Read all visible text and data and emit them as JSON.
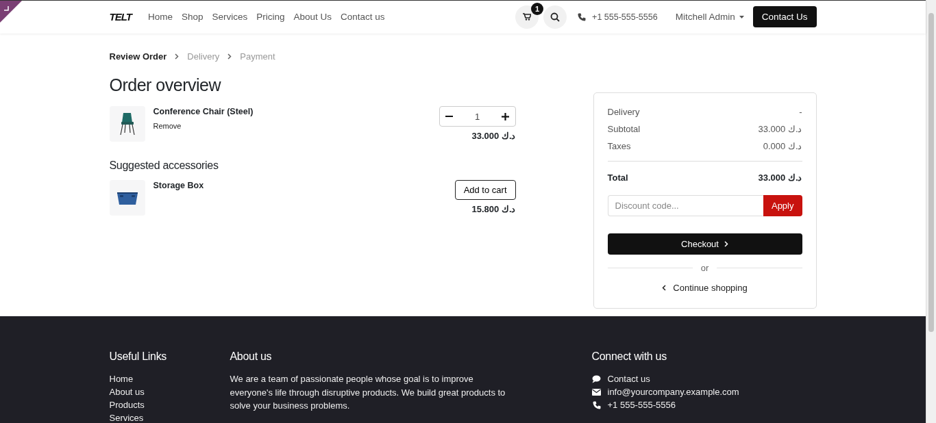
{
  "header": {
    "brand": "TELT",
    "nav": [
      {
        "label": "Home"
      },
      {
        "label": "Shop"
      },
      {
        "label": "Services"
      },
      {
        "label": "Pricing"
      },
      {
        "label": "About Us"
      },
      {
        "label": "Contact us"
      }
    ],
    "cart_count": "1",
    "phone": "+1 555-555-5556",
    "user": "Mitchell Admin",
    "cta": "Contact Us"
  },
  "steps": [
    {
      "label": "Review Order",
      "current": true
    },
    {
      "label": "Delivery",
      "current": false
    },
    {
      "label": "Payment",
      "current": false
    }
  ],
  "order": {
    "title": "Order overview",
    "lines": [
      {
        "kind": "chair",
        "name": "Conference Chair (Steel)",
        "action": "Remove",
        "quantity": "1",
        "price": "33.000 د.ك"
      }
    ]
  },
  "suggested": {
    "title": "Suggested accessories",
    "items": [
      {
        "kind": "box",
        "name": "Storage Box",
        "button": "Add to cart",
        "price": "15.800 د.ك"
      }
    ]
  },
  "summary": {
    "rows": [
      {
        "label": "Delivery",
        "value": "-"
      },
      {
        "label": "Subtotal",
        "value": "33.000 د.ك"
      },
      {
        "label": "Taxes",
        "value": "0.000 د.ك"
      }
    ],
    "total": {
      "label": "Total",
      "value": "33.000 د.ك"
    },
    "discount": {
      "placeholder": "Discount code...",
      "button": "Apply"
    },
    "checkout": "Checkout",
    "or": "or",
    "continue": "Continue shopping"
  },
  "footer": {
    "links_title": "Useful Links",
    "links": [
      "Home",
      "About us",
      "Products",
      "Services"
    ],
    "about_title": "About us",
    "about_text": "We are a team of passionate people whose goal is to improve everyone's life through disruptive products. We build great products to solve your business problems.",
    "connect_title": "Connect with us",
    "contacts": [
      {
        "kind": "chat",
        "text": "Contact us"
      },
      {
        "kind": "mail",
        "text": "info@yourcompany.example.com"
      },
      {
        "kind": "phone",
        "text": "+1 555-555-5556"
      }
    ]
  }
}
